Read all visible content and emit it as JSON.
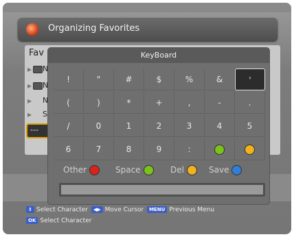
{
  "header": {
    "title": "Organizing Favorites",
    "logo_icon": "brand-logo-icon"
  },
  "fav_list": {
    "heading": "Fav",
    "rows": [
      {
        "label": "N"
      },
      {
        "label": "N"
      },
      {
        "label": "N"
      },
      {
        "label": "S"
      }
    ],
    "selected_label": "---"
  },
  "keyboard": {
    "title": "KeyBoard",
    "keys": [
      [
        "!",
        "\"",
        "#",
        "$",
        "%",
        "&",
        "'"
      ],
      [
        "(",
        ")",
        "*",
        "+",
        ",",
        "-",
        "."
      ],
      [
        "/",
        "0",
        "1",
        "2",
        "3",
        "4",
        "5"
      ],
      [
        "6",
        "7",
        "8",
        "9",
        ":",
        "",
        ""
      ]
    ],
    "selected_key": "'",
    "legend": [
      {
        "label": "Other",
        "color": "#d9231c"
      },
      {
        "label": "Space",
        "color": "#7cc21b"
      },
      {
        "label": "Del",
        "color": "#f2b21b"
      },
      {
        "label": "Save",
        "color": "#2f7fd4"
      }
    ],
    "input_value": ""
  },
  "footer": {
    "lines": [
      [
        {
          "badge": "⇕",
          "text": "Select Character"
        },
        {
          "badge": "◀▶",
          "text": "Move Cursor"
        },
        {
          "badge": "MENU",
          "text": "Previous Menu"
        }
      ],
      [
        {
          "badge": "OK",
          "text": "Select Character"
        }
      ]
    ]
  },
  "colors": {
    "green_key": "#7cc21b",
    "yellow_key": "#f2b21b"
  }
}
